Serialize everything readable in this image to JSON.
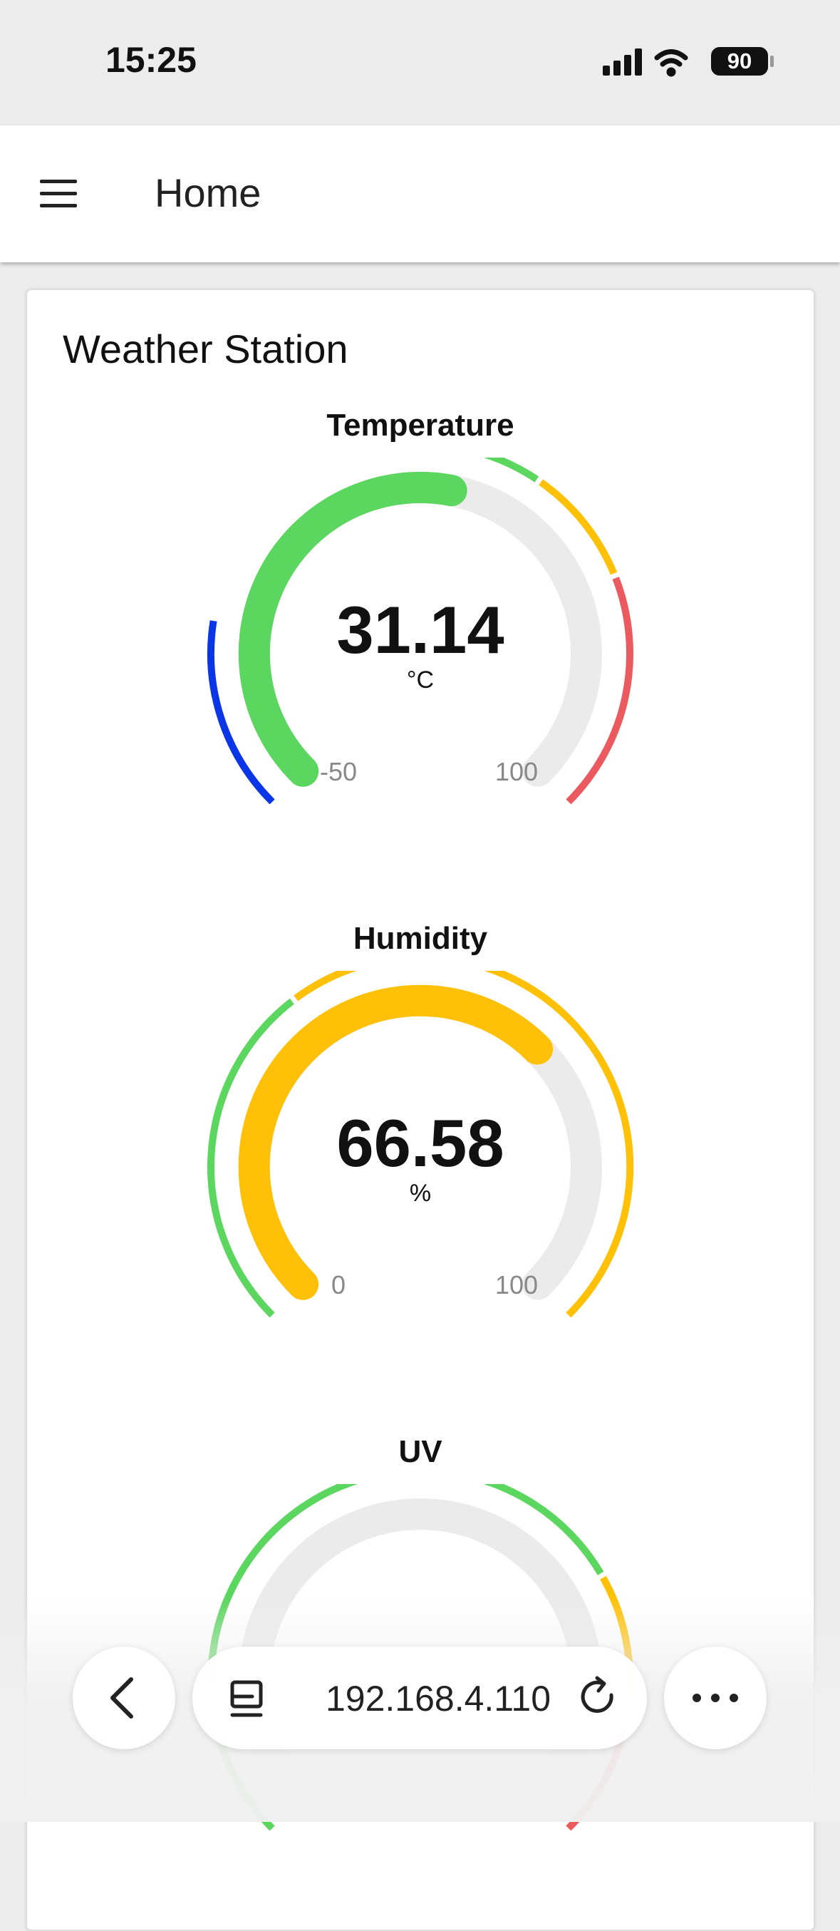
{
  "status_bar": {
    "time": "15:25",
    "battery": "90"
  },
  "app_bar": {
    "title": "Home"
  },
  "card": {
    "title": "Weather Station"
  },
  "gauges": [
    {
      "label": "Temperature",
      "value": "31.14",
      "unit": "°C",
      "min": "-50",
      "max": "100",
      "fraction": 0.54,
      "fill_color": "#5bd65e",
      "zones": [
        {
          "from": 0,
          "to": 0.2,
          "color": "#0a36e8"
        },
        {
          "from": 0.48,
          "to": 0.625,
          "color": "#5bd65e"
        },
        {
          "from": 0.63,
          "to": 0.75,
          "color": "#ffc107"
        },
        {
          "from": 0.755,
          "to": 1,
          "color": "#ea5a5f"
        }
      ]
    },
    {
      "label": "Humidity",
      "value": "66.58",
      "unit": "%",
      "min": "0",
      "max": "100",
      "fraction": 0.6658,
      "fill_color": "#ffc107",
      "zones": [
        {
          "from": 0,
          "to": 0.36,
          "color": "#5bd65e"
        },
        {
          "from": 0.365,
          "to": 1,
          "color": "#ffc107"
        }
      ]
    },
    {
      "label": "UV",
      "value": "",
      "unit": "",
      "min": "",
      "max": "",
      "fraction": 0.0,
      "fill_color": "#5bd65e",
      "zones": [
        {
          "from": 0,
          "to": 0.72,
          "color": "#5bd65e"
        },
        {
          "from": 0.725,
          "to": 0.88,
          "color": "#ffc107"
        },
        {
          "from": 0.885,
          "to": 1,
          "color": "#ea5a5f"
        }
      ]
    }
  ],
  "browser": {
    "url": "192.168.4.110"
  }
}
